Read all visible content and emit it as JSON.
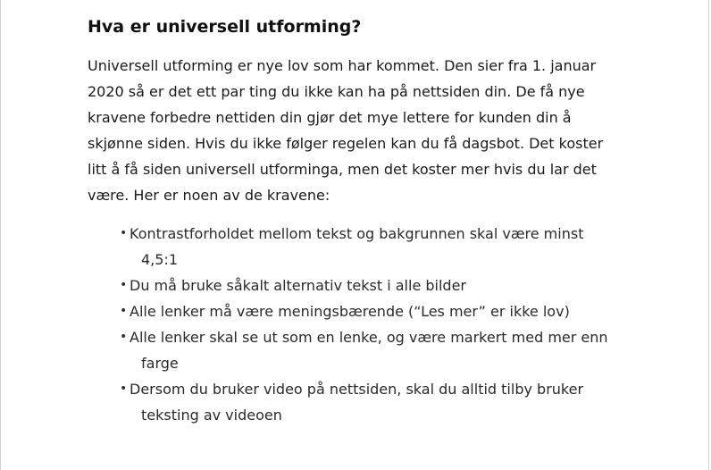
{
  "article": {
    "heading": "Hva er universell utforming?",
    "intro": "Universell utforming er nye lov som har kommet. Den sier fra 1. januar 2020 så er det ett par ting du ikke kan ha på nettsiden din. De få nye kravene forbedre nettiden din gjør det mye lettere for kunden din å skjønne siden. Hvis du ikke følger regelen kan du få dagsbot. Det koster litt å få siden universell utforminga, men det koster mer hvis du lar det være. Her er noen av de kravene:",
    "requirements": [
      "Kontrastforholdet mellom tekst og bakgrunnen skal være minst 4,5:1",
      "Du må bruke såkalt alternativ tekst i alle bilder",
      "Alle lenker må være meningsbærende (“Les mer” er ikke lov)",
      "Alle lenker skal se ut som en lenke, og være markert med mer enn farge",
      "Dersom du bruker video på nettsiden, skal du alltid tilby bruker teksting av videoen"
    ]
  }
}
